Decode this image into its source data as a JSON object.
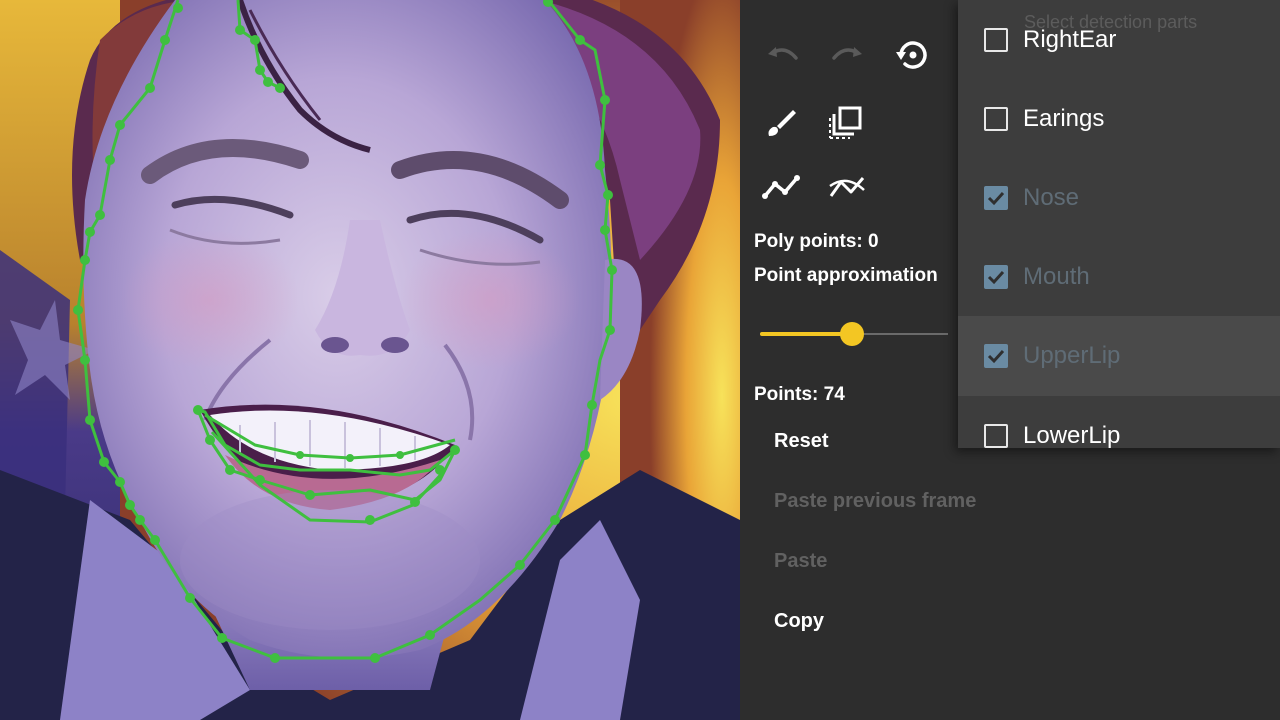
{
  "toolbar": {
    "undo_icon": "undo-icon",
    "redo_icon": "redo-icon",
    "reset_view_icon": "history-reset-icon",
    "brush_icon": "brush-icon",
    "layers_icon": "layers-icon",
    "polyline_icon": "polyline-icon",
    "approximate_icon": "polyline-approximate-icon"
  },
  "stats": {
    "poly_points": "Poly points: 0",
    "approximation_label": "Point approximation",
    "points": "Points: 74"
  },
  "slider": {
    "value_fraction": 0.49,
    "accent_color": "#f3c623"
  },
  "actions": [
    {
      "label": "Reset",
      "enabled": true
    },
    {
      "label": "Paste previous frame",
      "enabled": false
    },
    {
      "label": "Paste",
      "enabled": false
    },
    {
      "label": "Copy",
      "enabled": true
    }
  ],
  "parts_menu": {
    "heading": "Select detection parts",
    "items": [
      {
        "label": "RightEar",
        "checked": false,
        "enabled": true
      },
      {
        "label": "Earings",
        "checked": false,
        "enabled": true
      },
      {
        "label": "Nose",
        "checked": true,
        "enabled": false
      },
      {
        "label": "Mouth",
        "checked": true,
        "enabled": false
      },
      {
        "label": "UpperLip",
        "checked": true,
        "enabled": false
      },
      {
        "label": "LowerLip",
        "checked": false,
        "enabled": true
      }
    ]
  },
  "colors": {
    "panel_bg": "#2d2d2d",
    "menu_bg": "#3d3d3d",
    "outline_green": "#3fbf3f"
  }
}
